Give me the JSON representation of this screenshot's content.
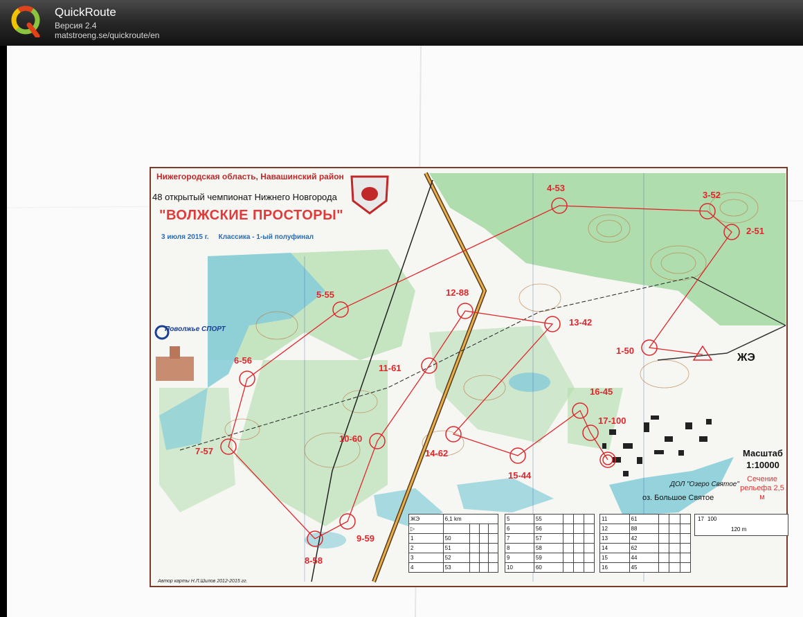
{
  "app": {
    "title": "QuickRoute",
    "version": "Версия 2.4",
    "url": "matstroeng.se/quickroute/en"
  },
  "map": {
    "region": "Нижегородская область, Навашинский район",
    "championship": "48 открытый чемпионат Нижнего Новгорода",
    "event": "\"ВОЛЖСКИЕ ПРОСТОРЫ\"",
    "date_line": "3 июля 2015 г.     Классика - 1-ый полуфинал",
    "sponsor": "Поволжье СПОРТ",
    "zhe": "ЖЭ",
    "scale": "Масштаб 1:10000",
    "relief": "Сечение рельефа 2,5 м",
    "dol": "ДОЛ \"Озеро Святое\"",
    "lake": "оз. Большое Святое",
    "author": "Автор карты Н.Л.Шилов 2012-2015 гг.",
    "controls": [
      {
        "label": "1-50"
      },
      {
        "label": "2-51"
      },
      {
        "label": "3-52"
      },
      {
        "label": "4-53"
      },
      {
        "label": "5-55"
      },
      {
        "label": "6-56"
      },
      {
        "label": "7-57"
      },
      {
        "label": "8-58"
      },
      {
        "label": "9-59"
      },
      {
        "label": "10-60"
      },
      {
        "label": "11-61"
      },
      {
        "label": "12-88"
      },
      {
        "label": "13-42"
      },
      {
        "label": "14-62"
      },
      {
        "label": "15-44"
      },
      {
        "label": "16-45"
      },
      {
        "label": "17-100"
      }
    ]
  },
  "description": {
    "header": [
      "ЖЭ",
      "6,1 km"
    ],
    "col1": [
      [
        "▷",
        ""
      ],
      [
        "1",
        "50"
      ],
      [
        "2",
        "51"
      ],
      [
        "3",
        "52"
      ],
      [
        "4",
        "53"
      ]
    ],
    "col2": [
      [
        "5",
        "55"
      ],
      [
        "6",
        "56"
      ],
      [
        "7",
        "57"
      ],
      [
        "8",
        "58"
      ],
      [
        "9",
        "59"
      ],
      [
        "10",
        "60"
      ]
    ],
    "col3": [
      [
        "11",
        "61"
      ],
      [
        "12",
        "88"
      ],
      [
        "13",
        "42"
      ],
      [
        "14",
        "62"
      ],
      [
        "15",
        "44"
      ],
      [
        "16",
        "45"
      ]
    ],
    "finish": [
      "17",
      "100"
    ],
    "finish_dist": "120 m"
  },
  "colors": {
    "accent": "#e0262c",
    "vegetation": "#8fd08c",
    "water": "#7ecbd6",
    "contour": "#b06a3c"
  }
}
